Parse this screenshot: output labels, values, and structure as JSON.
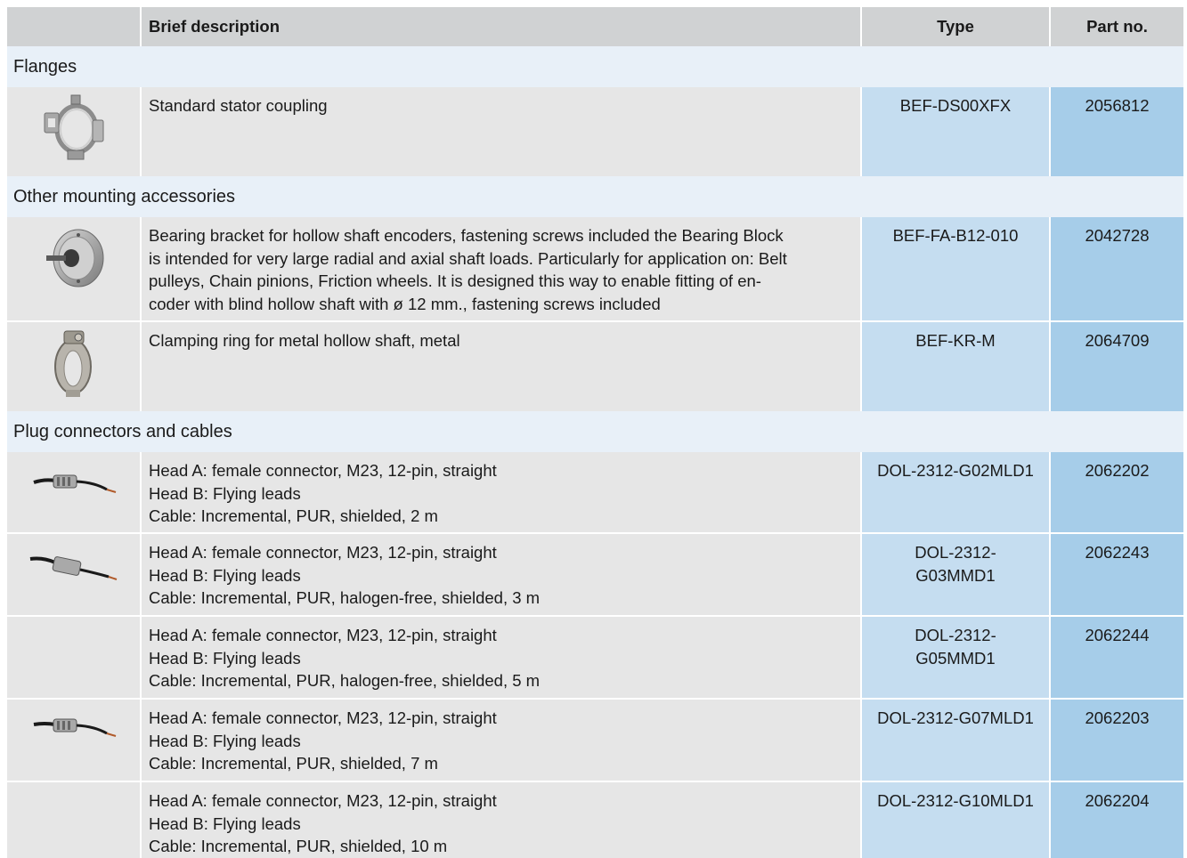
{
  "header": {
    "col_image": "",
    "col_description": "Brief description",
    "col_type": "Type",
    "col_part": "Part no."
  },
  "sections": [
    {
      "label": "Flanges",
      "items": [
        {
          "icon": "stator-coupling-icon",
          "description": [
            "Standard stator coupling"
          ],
          "type": "BEF-DS00XFX",
          "part": "2056812"
        }
      ]
    },
    {
      "label": "Other mounting accessories",
      "items": [
        {
          "icon": "bearing-bracket-icon",
          "description": [
            "Bearing bracket for hollow shaft encoders, fastening screws included the Bearing Block",
            "is intended for very large radial and axial shaft loads. Particularly for application on: Belt",
            "pulleys, Chain pinions, Friction wheels. It is designed this way to enable fitting of en-",
            "coder with blind hollow shaft with ø 12 mm., fastening screws included"
          ],
          "type": "BEF-FA-B12-010",
          "part": "2042728"
        },
        {
          "icon": "clamping-ring-icon",
          "description": [
            "Clamping ring for metal hollow shaft, metal"
          ],
          "type": "BEF-KR-M",
          "part": "2064709"
        }
      ]
    },
    {
      "label": "Plug connectors and cables",
      "items": [
        {
          "icon": "cable-connector-icon",
          "description": [
            "Head A: female connector, M23, 12-pin, straight",
            "Head B: Flying leads",
            "Cable: Incremental, PUR, shielded, 2 m"
          ],
          "type": "DOL-2312-G02MLD1",
          "part": "2062202"
        },
        {
          "icon": "cable-connector-icon",
          "description": [
            "Head A: female connector, M23, 12-pin, straight",
            "Head B: Flying leads",
            "Cable: Incremental, PUR, halogen-free, shielded, 3 m"
          ],
          "type": "DOL-2312-\nG03MMD1",
          "part": "2062243"
        },
        {
          "icon": "",
          "description": [
            "Head A: female connector, M23, 12-pin, straight",
            "Head B: Flying leads",
            "Cable: Incremental, PUR, halogen-free, shielded, 5 m"
          ],
          "type": "DOL-2312-\nG05MMD1",
          "part": "2062244"
        },
        {
          "icon": "cable-connector-icon",
          "description": [
            "Head A: female connector, M23, 12-pin, straight",
            "Head B: Flying leads",
            "Cable: Incremental, PUR, shielded, 7 m"
          ],
          "type": "DOL-2312-G07MLD1",
          "part": "2062203"
        },
        {
          "icon": "",
          "description": [
            "Head A: female connector, M23, 12-pin, straight",
            "Head B: Flying leads",
            "Cable: Incremental, PUR, shielded, 10 m"
          ],
          "type": "DOL-2312-G10MLD1",
          "part": "2062204"
        }
      ]
    }
  ]
}
